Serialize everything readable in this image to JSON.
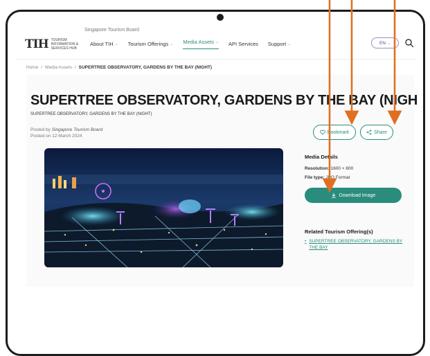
{
  "header": {
    "logo_mark": "TIH",
    "logo_text": "TOURISM INFORMATION & SERVICES HUB",
    "stb_label": "Singapore Tourism Board",
    "nav": [
      {
        "label": "About TIH",
        "dropdown": true,
        "active": false
      },
      {
        "label": "Tourism Offerings",
        "dropdown": true,
        "active": false
      },
      {
        "label": "Media Assets",
        "dropdown": true,
        "active": true
      },
      {
        "label": "API Services",
        "dropdown": false,
        "active": false
      },
      {
        "label": "Support",
        "dropdown": true,
        "active": false
      }
    ],
    "language": "EN",
    "search_icon": "search-icon"
  },
  "breadcrumb": {
    "home": "Home",
    "separator": "/",
    "media_assets": "Media Assets",
    "current": "SUPERTREE OBSERVATORY, GARDENS BY THE BAY (NIGHT)"
  },
  "asset": {
    "title": "SUPERTREE OBSERVATORY, GARDENS BY THE BAY (NIGHT)",
    "subtitle": "SUPERTREE OBSERVATORY, GARDENS BY THE BAY (NIGHT)",
    "posted_by_label": "Posted by",
    "posted_by": "Singapore Tourism Board",
    "posted_on": "Posted on 12 March 2024"
  },
  "actions": {
    "bookmark_label": "Bookmark",
    "share_label": "Share",
    "download_label": "Download Image"
  },
  "media_details": {
    "heading": "Media Details",
    "resolution_label": "Resolution:",
    "resolution_value": "1600 × 800",
    "file_type_label": "File type:",
    "file_type_value": "JPG Format"
  },
  "related": {
    "heading": "Related Tourism Offering(s)",
    "items": [
      "SUPERTREE OBSERVATORY, GARDENS BY THE BAY"
    ]
  },
  "colors": {
    "brand_teal": "#2a8c7c",
    "arrow_orange": "#e07020",
    "frame": "#1c1c1c"
  }
}
